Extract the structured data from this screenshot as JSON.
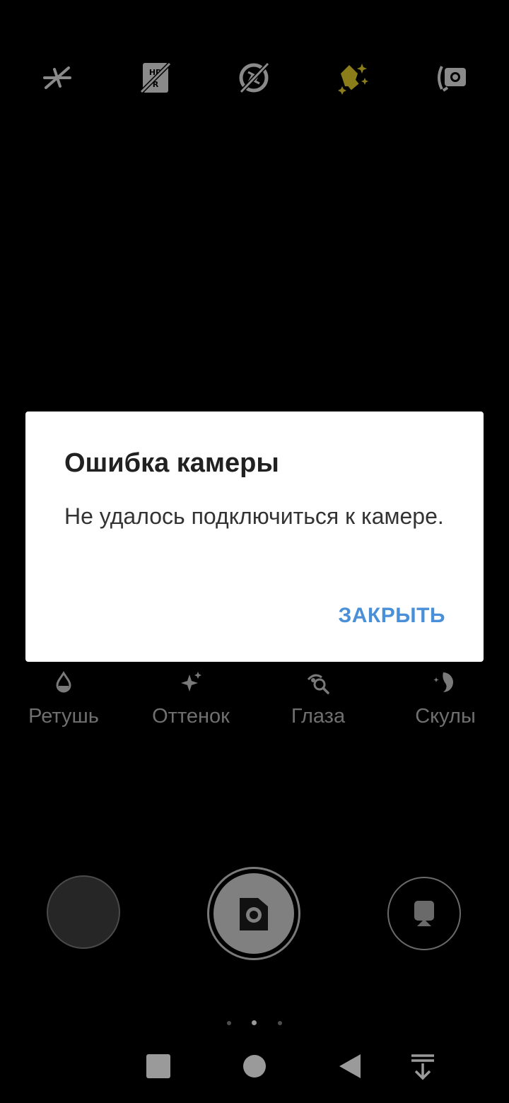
{
  "top_toolbar": {
    "icons": [
      {
        "name": "flash-off-icon",
        "color": "#8a8a8a"
      },
      {
        "name": "hdr-off-icon",
        "color": "#8a8a8a"
      },
      {
        "name": "timer-off-icon",
        "color": "#8a8a8a"
      },
      {
        "name": "beauty-mode-icon",
        "color": "#8b7d1a"
      },
      {
        "name": "switch-camera-icon",
        "color": "#8a8a8a"
      }
    ]
  },
  "beauty_options": {
    "items": [
      {
        "label": "Ретушь",
        "icon": "drop-icon"
      },
      {
        "label": "Оттенок",
        "icon": "sparkle-icon"
      },
      {
        "label": "Глаза",
        "icon": "eye-search-icon"
      },
      {
        "label": "Скулы",
        "icon": "face-icon"
      }
    ]
  },
  "shutter_row": {
    "gallery_icon": "gallery-thumbnail",
    "shutter_icon": "camera-icon",
    "mode_icon": "portrait-icon"
  },
  "pager": {
    "count": 3,
    "active_index": 1
  },
  "navbar": {
    "icons": [
      "recents-icon",
      "home-icon",
      "back-icon",
      "notification-pull-icon"
    ]
  },
  "dialog": {
    "title": "Ошибка камеры",
    "message": "Не удалось подключиться к камере.",
    "button_label": "ЗАКРЫТЬ",
    "accent_color": "#4a90d9"
  }
}
